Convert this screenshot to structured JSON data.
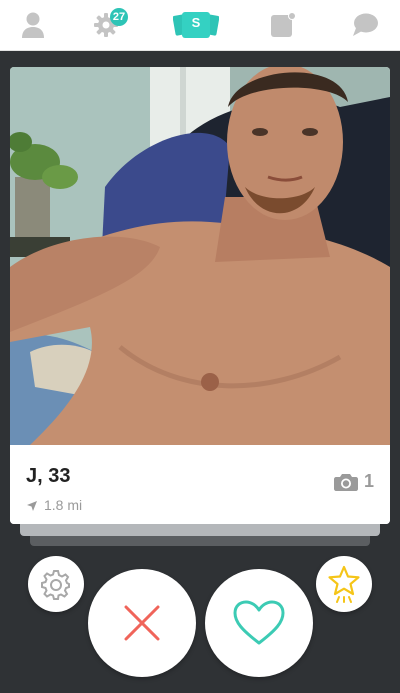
{
  "nav": {
    "items": [
      {
        "id": "profile",
        "icon": "person-icon"
      },
      {
        "id": "notifications",
        "icon": "gear-badge-icon",
        "badge": "27"
      },
      {
        "id": "discover",
        "icon": "s-cards-icon",
        "label": "S",
        "active": true
      },
      {
        "id": "updates",
        "icon": "card-dot-icon"
      },
      {
        "id": "messages",
        "icon": "chat-bubble-icon"
      }
    ],
    "colors": {
      "inactive": "#c4c4c4",
      "accent": "#2ec4b6"
    }
  },
  "profile": {
    "name_age": "J, 33",
    "distance": "1.8 mi",
    "photo_count": "1"
  },
  "actions": [
    {
      "id": "settings",
      "icon": "gear-icon"
    },
    {
      "id": "pass",
      "icon": "x-icon",
      "color": "#f0645a"
    },
    {
      "id": "like",
      "icon": "heart-icon",
      "color": "#3ccbb4"
    },
    {
      "id": "super",
      "icon": "star-icon",
      "color": "#f5c518"
    }
  ]
}
